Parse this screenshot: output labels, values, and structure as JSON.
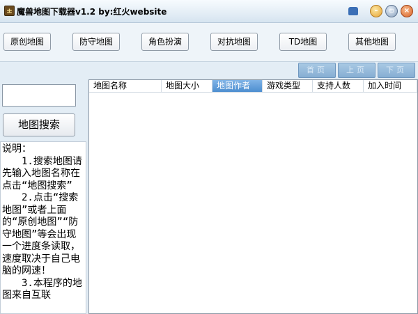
{
  "window": {
    "title": "魔兽地图下载器v1.2   by:红火website",
    "app_icon_glyph": "±"
  },
  "toolbar": {
    "categories": [
      "原创地图",
      "防守地图",
      "角色扮演",
      "对抗地图",
      "TD地图",
      "其他地图"
    ]
  },
  "pager": {
    "first": "首页",
    "prev": "上页",
    "next": "下页"
  },
  "search": {
    "input_value": "",
    "button_label": "地图搜索"
  },
  "instructions": {
    "heading": "说明：",
    "step1": "1.搜索地图请先输入地图名称在点击“地图搜索”",
    "step2": "2.点击“搜索地图”或者上面的“原创地图”“防守地图”等会出现一个进度条读取，速度取决于自己电脑的网速！",
    "step3": "3.本程序的地图来自互联"
  },
  "table": {
    "columns": [
      "地图名称",
      "地图大小",
      "地图作者",
      "游戏类型",
      "支持人数",
      "加入时间"
    ],
    "selected_column": "地图作者",
    "rows": []
  },
  "colors": {
    "header_selected": "#4d8ed0",
    "window_bg": "#e3edf5",
    "pager_bg": "#86aed3"
  }
}
